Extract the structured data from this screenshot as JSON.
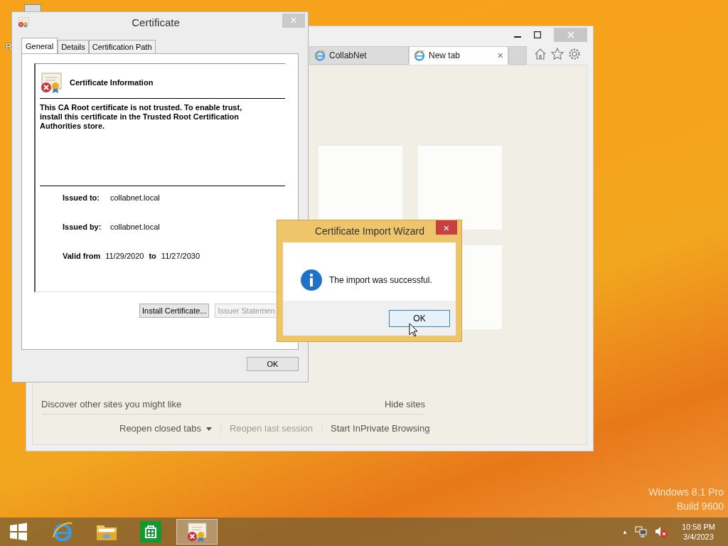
{
  "desktop": {
    "icon_label": "R",
    "watermark": [
      "Windows 8.1 Pro",
      "Build 9600"
    ]
  },
  "browser": {
    "tabs": [
      {
        "label": "CollabNet",
        "selected": false
      },
      {
        "label": "New tab",
        "selected": true,
        "close": "×"
      }
    ],
    "discover": "Discover other sites you might like",
    "hide": "Hide sites",
    "links": [
      {
        "label": "Reopen closed tabs",
        "disabled": false,
        "dropdown": true
      },
      {
        "label": "Reopen last session",
        "disabled": true,
        "dropdown": false
      },
      {
        "label": "Start InPrivate Browsing",
        "disabled": false,
        "dropdown": false
      }
    ]
  },
  "certificate": {
    "title": "Certificate",
    "close": "×",
    "tabs": [
      {
        "label": "General",
        "selected": true
      },
      {
        "label": "Details",
        "selected": false
      },
      {
        "label": "Certification Path",
        "selected": false
      }
    ],
    "heading": "Certificate Information",
    "message": "This CA Root certificate is not trusted. To enable trust, install this certificate in the Trusted Root Certification Authorities store.",
    "fields": [
      {
        "label": "Issued to:",
        "value": "collabnet.local"
      },
      {
        "label": "Issued by:",
        "value": "collabnet.local"
      }
    ],
    "valid": {
      "label": "Valid from",
      "from": "11/29/2020",
      "to_label": "to",
      "to": "11/27/2030"
    },
    "buttons": [
      {
        "label": "Install Certificate...",
        "disabled": false
      },
      {
        "label": "Issuer Statemen",
        "disabled": true
      }
    ],
    "ok": "OK"
  },
  "wizard": {
    "title": "Certificate Import Wizard",
    "close": "×",
    "message": "The import was successful.",
    "ok": "OK"
  },
  "taskbar": {
    "items": [
      {
        "kind": "start",
        "selected": false
      },
      {
        "kind": "ie",
        "selected": false
      },
      {
        "kind": "explorer",
        "selected": false
      },
      {
        "kind": "store",
        "selected": false
      },
      {
        "kind": "certificate",
        "selected": true
      }
    ],
    "tray_caret": "▲",
    "time": "10:58 PM",
    "date": "3/4/2023"
  }
}
